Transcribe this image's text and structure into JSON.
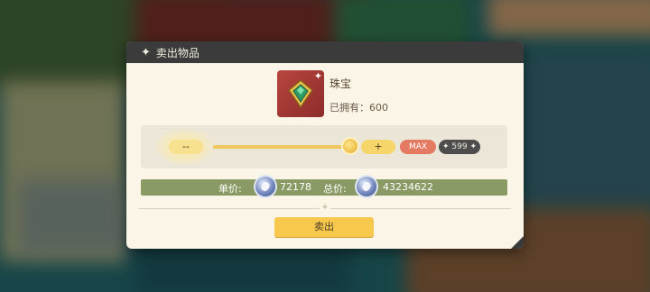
{
  "dialog": {
    "title": "卖出物品"
  },
  "item": {
    "name": "珠宝",
    "owned_label": "已拥有：600",
    "icon": "emerald-jewelry-icon"
  },
  "quantity": {
    "minus_label": "--",
    "plus_label": "+",
    "max_label": "MAX",
    "count": "599",
    "slider_fraction": 0.998
  },
  "price": {
    "unit_label": "单价:",
    "unit_value": "72178",
    "total_label": "总价:",
    "total_value": "43234622",
    "currency_icon": "silver-coin-icon"
  },
  "actions": {
    "sell_label": "卖出"
  },
  "colors": {
    "title_bar": "#3b3b3b",
    "panel": "#fbf5e8",
    "accent_yellow": "#f7c84b",
    "max_red": "#e57a63",
    "price_bar": "#8a9a64"
  }
}
